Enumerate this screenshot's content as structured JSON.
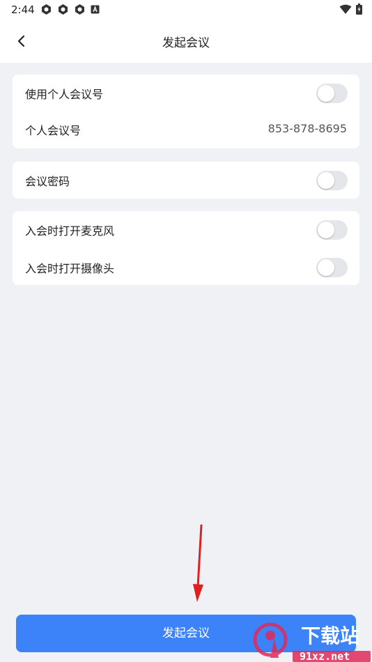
{
  "status_bar": {
    "time": "2:44"
  },
  "header": {
    "title": "发起会议"
  },
  "sections": [
    {
      "rows": [
        {
          "label": "使用个人会议号",
          "type": "toggle",
          "on": false
        },
        {
          "label": "个人会议号",
          "type": "value",
          "value": "853-878-8695"
        }
      ]
    },
    {
      "rows": [
        {
          "label": "会议密码",
          "type": "toggle",
          "on": false
        }
      ]
    },
    {
      "rows": [
        {
          "label": "入会时打开麦克风",
          "type": "toggle",
          "on": false
        },
        {
          "label": "入会时打开摄像头",
          "type": "toggle",
          "on": false
        }
      ]
    }
  ],
  "primary_button": {
    "label": "发起会议"
  },
  "watermark": {
    "text_main": "下载站",
    "text_url": "91xz.net"
  },
  "colors": {
    "accent": "#3c82f8",
    "background": "#f0f1f4",
    "toggle_off": "#e4e6ea",
    "annotation_arrow": "#e02020"
  }
}
